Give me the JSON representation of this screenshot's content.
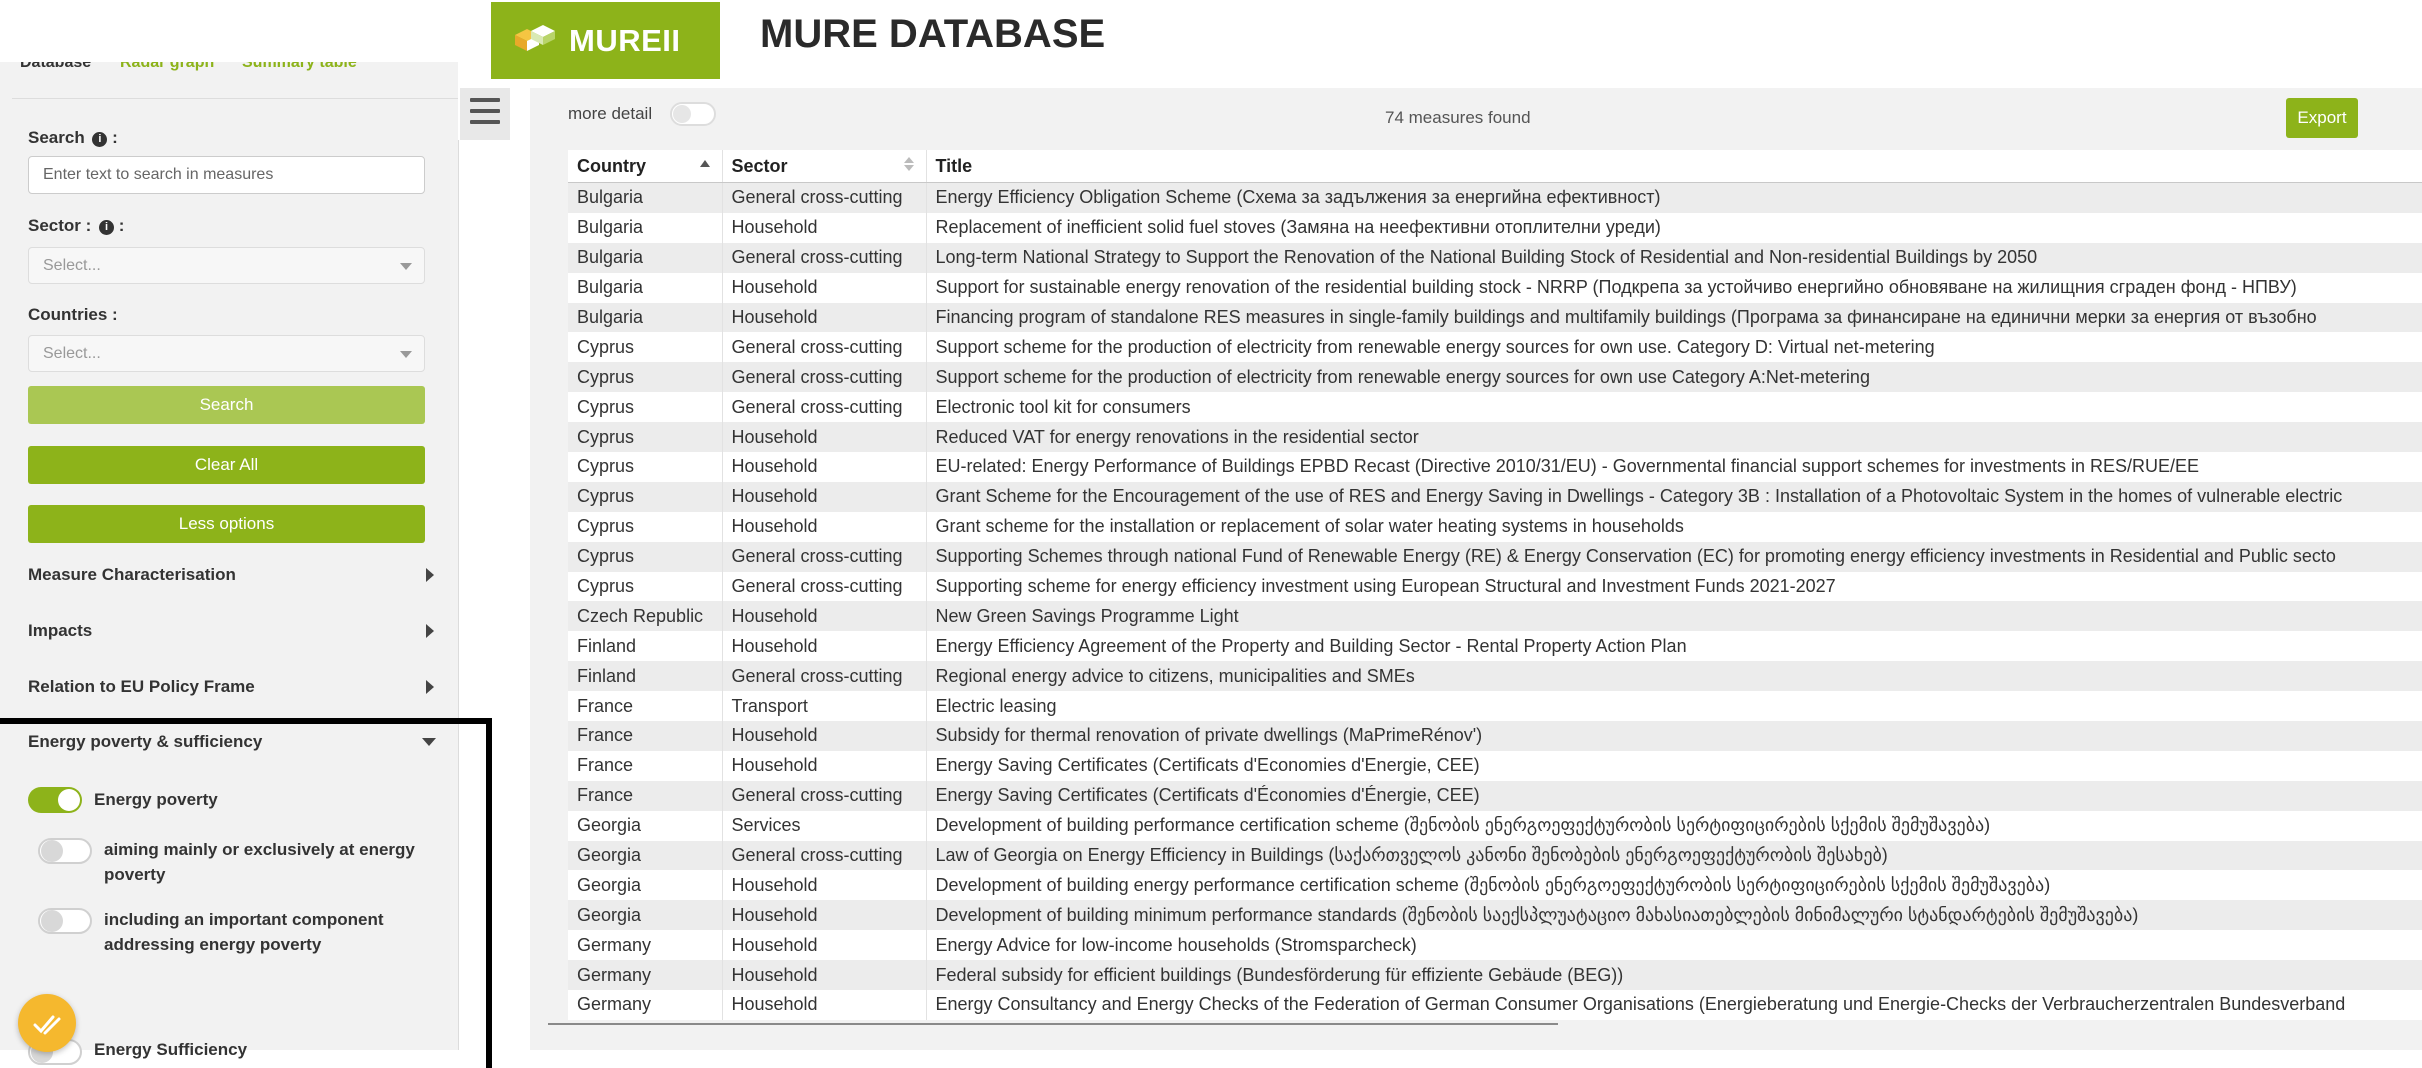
{
  "header": {
    "logo_text": "MUREII",
    "title": "MURE DATABASE"
  },
  "sidebar": {
    "tabs": [
      "Database",
      "Radar graph",
      "Summary table"
    ],
    "search_label": "Search",
    "search_placeholder": "Enter text to search in measures",
    "sector_label": "Sector :",
    "sector_placeholder": "Select...",
    "countries_label": "Countries :",
    "countries_placeholder": "Select...",
    "search_button": "Search",
    "clear_button": "Clear All",
    "less_button": "Less options",
    "sections": [
      "Measure Characterisation",
      "Impacts",
      "Relation to EU Policy Frame",
      "Energy poverty & sufficiency"
    ],
    "toggles": {
      "energy_poverty": {
        "label": "Energy poverty",
        "on": true
      },
      "aiming": {
        "label": "aiming mainly or exclusively at energy poverty",
        "on": false
      },
      "including": {
        "label": "including an important component addressing energy poverty",
        "on": false
      },
      "sufficiency": {
        "label": "Energy Sufficiency",
        "on": false
      }
    }
  },
  "main": {
    "more_detail_label": "more detail",
    "measures_found": "74 measures found",
    "export_button": "Export",
    "columns": [
      "Country",
      "Sector",
      "Title"
    ],
    "rows": [
      [
        "Bulgaria",
        "General cross-cutting",
        "Energy Efficiency Obligation Scheme (Схема за задължения за енергийна ефективност)"
      ],
      [
        "Bulgaria",
        "Household",
        "Replacement of inefficient solid fuel stoves (Замяна на неефективни отоплителни уреди)"
      ],
      [
        "Bulgaria",
        "General cross-cutting",
        "Long-term National Strategy to Support the Renovation of the National Building Stock of Residential and Non-residential Buildings by 2050"
      ],
      [
        "Bulgaria",
        "Household",
        "Support for sustainable energy renovation of the residential building stock - NRRP (Подкрепа за устойчиво енергийно обновяване на жилищния сграден фонд - НПВУ)"
      ],
      [
        "Bulgaria",
        "Household",
        "Financing program of standalone RES measures in single-family buildings and multifamily buildings (Програма за финансиране на единични мерки за енергия от възобно"
      ],
      [
        "Cyprus",
        "General cross-cutting",
        "Support scheme for the production of electricity from renewable energy sources for own use. Category D: Virtual net-metering"
      ],
      [
        "Cyprus",
        "General cross-cutting",
        "Support scheme for the production of electricity from renewable energy sources for own use Category A:Net-metering"
      ],
      [
        "Cyprus",
        "General cross-cutting",
        "Electronic tool kit for consumers"
      ],
      [
        "Cyprus",
        "Household",
        "Reduced VAT for energy renovations in the residential sector"
      ],
      [
        "Cyprus",
        "Household",
        "EU-related: Energy Performance of Buildings EPBD Recast (Directive 2010/31/EU) - Governmental financial support schemes for investments in RES/RUE/EE"
      ],
      [
        "Cyprus",
        "Household",
        "Grant Scheme for the Encouragement of the use of RES and Energy Saving in Dwellings - Category 3B : Installation of a Photovoltaic System in the homes of vulnerable electric"
      ],
      [
        "Cyprus",
        "Household",
        "Grant scheme for the installation or replacement of solar water heating systems in households"
      ],
      [
        "Cyprus",
        "General cross-cutting",
        "Supporting Schemes through national Fund of Renewable Energy (RE) & Energy Conservation (EC) for promoting energy efficiency investments in Residential and Public secto"
      ],
      [
        "Cyprus",
        "General cross-cutting",
        "Supporting scheme for energy efficiency investment using European Structural and Investment Funds 2021-2027"
      ],
      [
        "Czech Republic",
        "Household",
        "New Green Savings Programme Light"
      ],
      [
        "Finland",
        "Household",
        "Energy Efficiency Agreement of the Property and Building Sector - Rental Property Action Plan"
      ],
      [
        "Finland",
        "General cross-cutting",
        "Regional energy advice to citizens, municipalities and SMEs"
      ],
      [
        "France",
        "Transport",
        "Electric leasing"
      ],
      [
        "France",
        "Household",
        "Subsidy for thermal renovation of private dwellings (MaPrimeRénov')"
      ],
      [
        "France",
        "Household",
        "Energy Saving Certificates (Certificats d'Economies d'Energie, CEE)"
      ],
      [
        "France",
        "General cross-cutting",
        "Energy Saving Certificates (Certificats d'Économies d'Énergie, CEE)"
      ],
      [
        "Georgia",
        "Services",
        "Development of building performance certification scheme (შენობის ენერგოეფექტურობის სერტიფიცირების სქემის შემუშავება)"
      ],
      [
        "Georgia",
        "General cross-cutting",
        "Law of Georgia on Energy Efficiency in Buildings (საქართველოს კანონი შენობების ენერგოეფექტურობის შესახებ)"
      ],
      [
        "Georgia",
        "Household",
        "Development of building energy performance certification scheme (შენობის ენერგოეფექტურობის სერტიფიცირების სქემის შემუშავება)"
      ],
      [
        "Georgia",
        "Household",
        "Development of building minimum performance standards (შენობის საექსპლუატაციო მახასიათებლების მინიმალური სტანდარტების შემუშავება)"
      ],
      [
        "Germany",
        "Household",
        "Energy Advice for low-income households (Stromsparcheck)"
      ],
      [
        "Germany",
        "Household",
        "Federal subsidy for efficient buildings (Bundesförderung für effiziente Gebäude (BEG))"
      ],
      [
        "Germany",
        "Household",
        "Energy Consultancy and Energy Checks of the Federation of German Consumer Organisations (Energieberatung und Energie-Checks der Verbraucherzentralen Bundesverband"
      ]
    ]
  },
  "colors": {
    "brand_green": "#8db31a",
    "light_green": "#aac753",
    "fab_yellow": "#f5b82e"
  }
}
